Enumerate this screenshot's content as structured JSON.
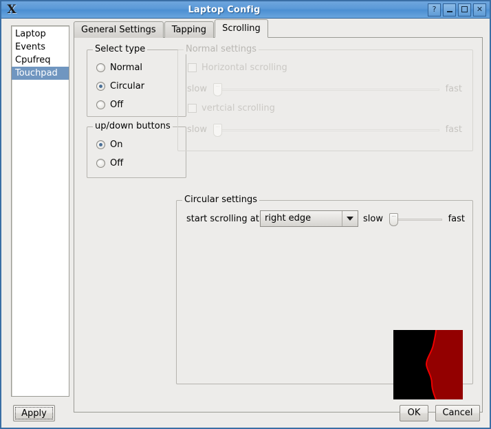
{
  "window": {
    "title": "Laptop Config",
    "logo_icon": "x-logo-icon",
    "buttons": {
      "help": "?",
      "minimize": "_",
      "maximize": "□",
      "close": "✕"
    }
  },
  "sidebar": {
    "items": [
      {
        "label": "Laptop",
        "selected": false
      },
      {
        "label": "Events",
        "selected": false
      },
      {
        "label": "Cpufreq",
        "selected": false
      },
      {
        "label": "Touchpad",
        "selected": true
      }
    ],
    "selection_color": "#7096c0"
  },
  "tabs": [
    {
      "label": "General Settings",
      "active": false
    },
    {
      "label": "Tapping",
      "active": false
    },
    {
      "label": "Scrolling",
      "active": true
    }
  ],
  "select_type": {
    "legend": "Select type",
    "options": [
      {
        "label": "Normal",
        "selected": false
      },
      {
        "label": "Circular",
        "selected": true
      },
      {
        "label": "Off",
        "selected": false
      }
    ]
  },
  "updown_buttons": {
    "legend": "up/down buttons",
    "options": [
      {
        "label": "On",
        "selected": true
      },
      {
        "label": "Off",
        "selected": false
      }
    ]
  },
  "normal_settings": {
    "legend": "Normal settings",
    "enabled": false,
    "horizontal": {
      "label": "Horizontal scrolling",
      "checked": false,
      "slider": {
        "min_label": "slow",
        "max_label": "fast",
        "value": 0
      }
    },
    "vertical": {
      "label": "vertcial scrolling",
      "checked": false,
      "slider": {
        "min_label": "slow",
        "max_label": "fast",
        "value": 0
      }
    }
  },
  "circular_settings": {
    "legend": "Circular settings",
    "start_label": "start scrolling at:",
    "combo": {
      "value": "right edge",
      "arrow_icon": "chevron-down-icon"
    },
    "slider": {
      "min_label": "slow",
      "max_label": "fast",
      "value": 0
    },
    "preview": {
      "name": "touchpad-corner-preview",
      "background_color": "#000000",
      "region_color": "#cc0000"
    }
  },
  "footer": {
    "apply": "Apply",
    "ok": "OK",
    "cancel": "Cancel"
  }
}
